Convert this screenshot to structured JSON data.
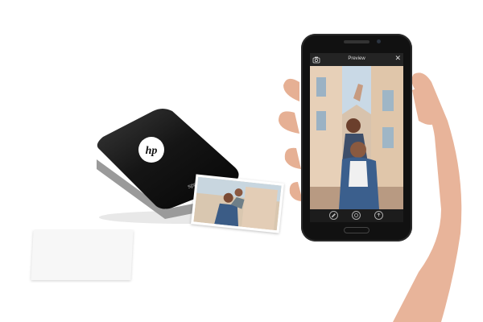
{
  "printer": {
    "brand_logo": "hp",
    "model_label": "sprocket"
  },
  "phone_app": {
    "screen_title": "Preview",
    "top_icons": [
      "camera-icon",
      "close-icon"
    ],
    "bottom_tools": [
      "edit-tool-icon",
      "print-tool-icon",
      "share-tool-icon"
    ]
  },
  "colors": {
    "printer_body": "#111111",
    "sky": "#c9d9e6",
    "building": "#e7d0b8"
  }
}
